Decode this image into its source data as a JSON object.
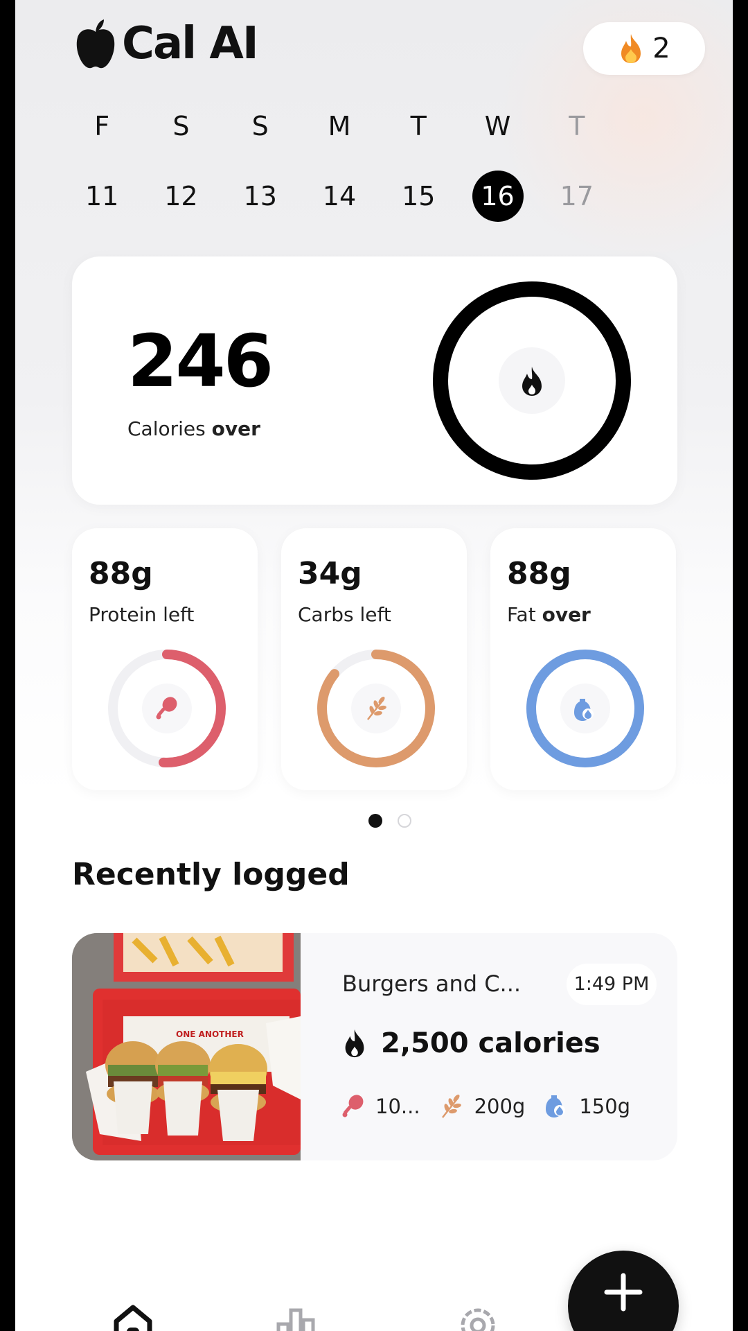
{
  "app": {
    "title": "Cal AI"
  },
  "streak": {
    "count": "2",
    "icon": "flame-icon"
  },
  "week": {
    "days": [
      {
        "letter": "F",
        "num": "11",
        "state": "past"
      },
      {
        "letter": "S",
        "num": "12",
        "state": "past"
      },
      {
        "letter": "S",
        "num": "13",
        "state": "past"
      },
      {
        "letter": "M",
        "num": "14",
        "state": "past"
      },
      {
        "letter": "T",
        "num": "15",
        "state": "past"
      },
      {
        "letter": "W",
        "num": "16",
        "state": "selected"
      },
      {
        "letter": "T",
        "num": "17",
        "state": "future"
      }
    ]
  },
  "calories": {
    "value": "246",
    "label_prefix": "Calories ",
    "label_emphasis": "over",
    "progress": 1.0,
    "icon": "flame-icon"
  },
  "macros": [
    {
      "value": "88g",
      "label_prefix": "Protein ",
      "label_emphasis": "",
      "label_suffix": "left",
      "progress": 0.51,
      "color": "#dd5f6c",
      "icon": "drumstick-icon"
    },
    {
      "value": "34g",
      "label_prefix": "Carbs ",
      "label_emphasis": "",
      "label_suffix": "left",
      "progress": 0.86,
      "color": "#dd9a6c",
      "icon": "wheat-icon"
    },
    {
      "value": "88g",
      "label_prefix": "Fat ",
      "label_emphasis": "over",
      "label_suffix": "",
      "progress": 1.0,
      "color": "#6e9ce0",
      "icon": "oil-drop-icon"
    }
  ],
  "pager": {
    "active": 0,
    "count": 2
  },
  "recent": {
    "title": "Recently logged",
    "items": [
      {
        "name": "Burgers and C...",
        "time": "1:49 PM",
        "calories": "2,500 calories",
        "protein": "10...",
        "carbs": "200g",
        "fat": "150g",
        "photo_text": "ONE ANOTHER"
      }
    ]
  },
  "colors": {
    "accent": "#111111",
    "protein": "#dd5f6c",
    "carbs": "#dd9a6c",
    "fat": "#6e9ce0",
    "ring_track": "#f0f0f3"
  },
  "nav": {
    "items": [
      "home-icon",
      "analytics-icon",
      "settings-icon"
    ],
    "fab": "plus-icon"
  }
}
